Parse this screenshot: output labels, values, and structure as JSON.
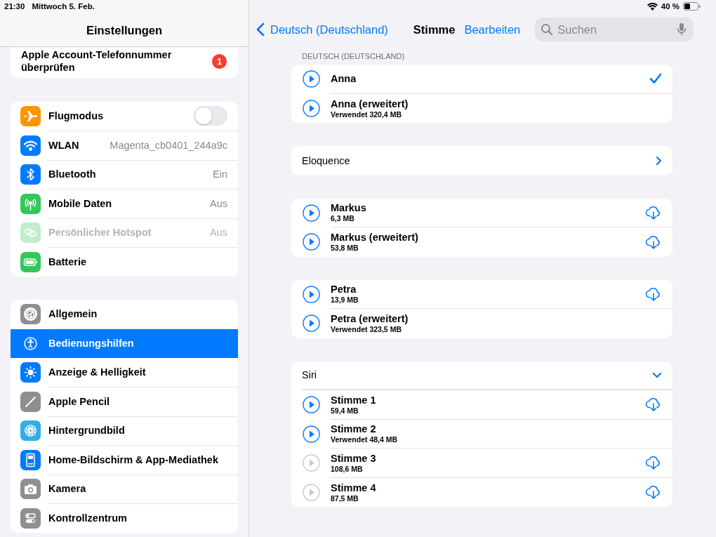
{
  "status_bar": {
    "time": "21:30",
    "date": "Mittwoch 5. Feb.",
    "battery": "40 %"
  },
  "sidebar": {
    "title": "Einstellungen",
    "account": {
      "text": "Apple Account-Telefonnummer überprüfen",
      "badge": "1"
    },
    "groups": [
      {
        "items": [
          {
            "label": "Flugmodus",
            "kind": "toggle",
            "on": false,
            "selected": false,
            "disabled": false
          },
          {
            "label": "WLAN",
            "kind": "value",
            "value": "Magenta_cb0401_244a9c",
            "selected": false,
            "disabled": false
          },
          {
            "label": "Bluetooth",
            "kind": "value",
            "value": "Ein",
            "selected": false,
            "disabled": false
          },
          {
            "label": "Mobile Daten",
            "kind": "value",
            "value": "Aus",
            "selected": false,
            "disabled": false
          },
          {
            "label": "Persönlicher Hotspot",
            "kind": "value",
            "value": "Aus",
            "selected": false,
            "disabled": true
          },
          {
            "label": "Batterie",
            "kind": "plain",
            "selected": false,
            "disabled": false
          }
        ]
      },
      {
        "items": [
          {
            "label": "Allgemein",
            "kind": "plain",
            "selected": false,
            "disabled": false
          },
          {
            "label": "Bedienungshilfen",
            "kind": "plain",
            "selected": true,
            "disabled": false
          },
          {
            "label": "Anzeige & Helligkeit",
            "kind": "plain",
            "selected": false,
            "disabled": false
          },
          {
            "label": "Apple Pencil",
            "kind": "plain",
            "selected": false,
            "disabled": false
          },
          {
            "label": "Hintergrundbild",
            "kind": "plain",
            "selected": false,
            "disabled": false
          },
          {
            "label": "Home-Bildschirm & App-Mediathek",
            "kind": "plain",
            "selected": false,
            "disabled": false
          },
          {
            "label": "Kamera",
            "kind": "plain",
            "selected": false,
            "disabled": false
          },
          {
            "label": "Kontrollzentrum",
            "kind": "plain",
            "selected": false,
            "disabled": false
          }
        ]
      }
    ]
  },
  "detail": {
    "back": "Deutsch (Deutschland)",
    "title": "Stimme",
    "edit": "Bearbeiten",
    "search": {
      "placeholder": "Suchen"
    },
    "sections": [
      {
        "header": "DEUTSCH (DEUTSCHLAND)",
        "rows": [
          {
            "kind": "voice",
            "name": "Anna",
            "checked": true,
            "available": true,
            "download": false
          },
          {
            "kind": "voice",
            "name": "Anna (erweitert)",
            "detail": "Verwendet 320,4 MB",
            "checked": false,
            "available": true,
            "download": false
          }
        ]
      },
      {
        "rows": [
          {
            "kind": "link",
            "name": "Eloquence"
          }
        ]
      },
      {
        "rows": [
          {
            "kind": "voice",
            "name": "Markus",
            "detail": "6,3 MB",
            "checked": false,
            "available": true,
            "download": true
          },
          {
            "kind": "voice",
            "name": "Markus (erweitert)",
            "detail": "53,8 MB",
            "checked": false,
            "available": true,
            "download": true
          }
        ]
      },
      {
        "rows": [
          {
            "kind": "voice",
            "name": "Petra",
            "detail": "13,9 MB",
            "checked": false,
            "available": true,
            "download": true
          },
          {
            "kind": "voice",
            "name": "Petra (erweitert)",
            "detail": "Verwendet 323,5 MB",
            "checked": false,
            "available": true,
            "download": false
          }
        ]
      },
      {
        "rows": [
          {
            "kind": "group",
            "name": "Siri",
            "expanded": true
          },
          {
            "kind": "voice",
            "name": "Stimme 1",
            "detail": "59,4 MB",
            "checked": false,
            "available": true,
            "download": true
          },
          {
            "kind": "voice",
            "name": "Stimme 2",
            "detail": "Verwendet 48,4 MB",
            "checked": false,
            "available": true,
            "download": false
          },
          {
            "kind": "voice",
            "name": "Stimme 3",
            "detail": "108,6 MB",
            "checked": false,
            "available": false,
            "download": true
          },
          {
            "kind": "voice",
            "name": "Stimme 4",
            "detail": "87,5 MB",
            "checked": false,
            "available": false,
            "download": true
          }
        ]
      }
    ]
  }
}
